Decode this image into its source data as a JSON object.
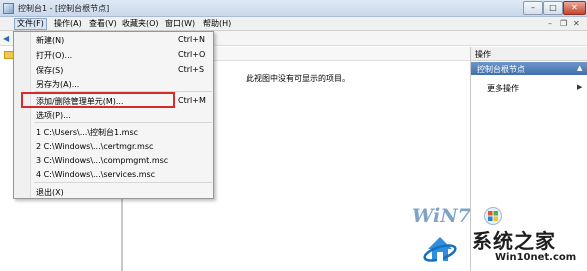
{
  "window": {
    "title": "控制台1 - [控制台根节点]"
  },
  "title_buttons": {
    "minimize": "–",
    "maximize": "□",
    "close": "✕"
  },
  "menubar": {
    "items": [
      {
        "label": "文件(F)"
      },
      {
        "label": "操作(A)"
      },
      {
        "label": "查看(V)"
      },
      {
        "label": "收藏夹(O)"
      },
      {
        "label": "窗口(W)"
      },
      {
        "label": "帮助(H)"
      }
    ],
    "mdi": {
      "minimize": "–",
      "restore": "❐",
      "close": "✕"
    }
  },
  "toolbar": {
    "back_icon": "arrow-left-icon",
    "back_glyph": "◀"
  },
  "file_menu": {
    "items": [
      {
        "label": "新建(N)",
        "shortcut": "Ctrl+N"
      },
      {
        "label": "打开(O)...",
        "shortcut": "Ctrl+O"
      },
      {
        "label": "保存(S)",
        "shortcut": "Ctrl+S"
      },
      {
        "label": "另存为(A)...",
        "shortcut": ""
      },
      {
        "label": "添加/删除管理单元(M)...",
        "shortcut": "Ctrl+M"
      },
      {
        "label": "选项(P)...",
        "shortcut": ""
      },
      {
        "label": "1 C:\\Users\\...\\控制台1.msc",
        "shortcut": ""
      },
      {
        "label": "2 C:\\Windows\\...\\certmgr.msc",
        "shortcut": ""
      },
      {
        "label": "3 C:\\Windows\\...\\compmgmt.msc",
        "shortcut": ""
      },
      {
        "label": "4 C:\\Windows\\...\\services.msc",
        "shortcut": ""
      },
      {
        "label": "退出(X)",
        "shortcut": ""
      }
    ],
    "highlight_color": "#d42b2b"
  },
  "center": {
    "empty_message": "此视图中没有可显示的项目。"
  },
  "actions": {
    "header": "操作",
    "node": "控制台根节点",
    "more": "更多操作",
    "expand_glyph": "▲",
    "more_glyph": "▶",
    "node_color": "#4a79b5"
  },
  "watermark": {
    "logo": "WiN7",
    "name": "系统之家",
    "url": "Win10net.com"
  }
}
